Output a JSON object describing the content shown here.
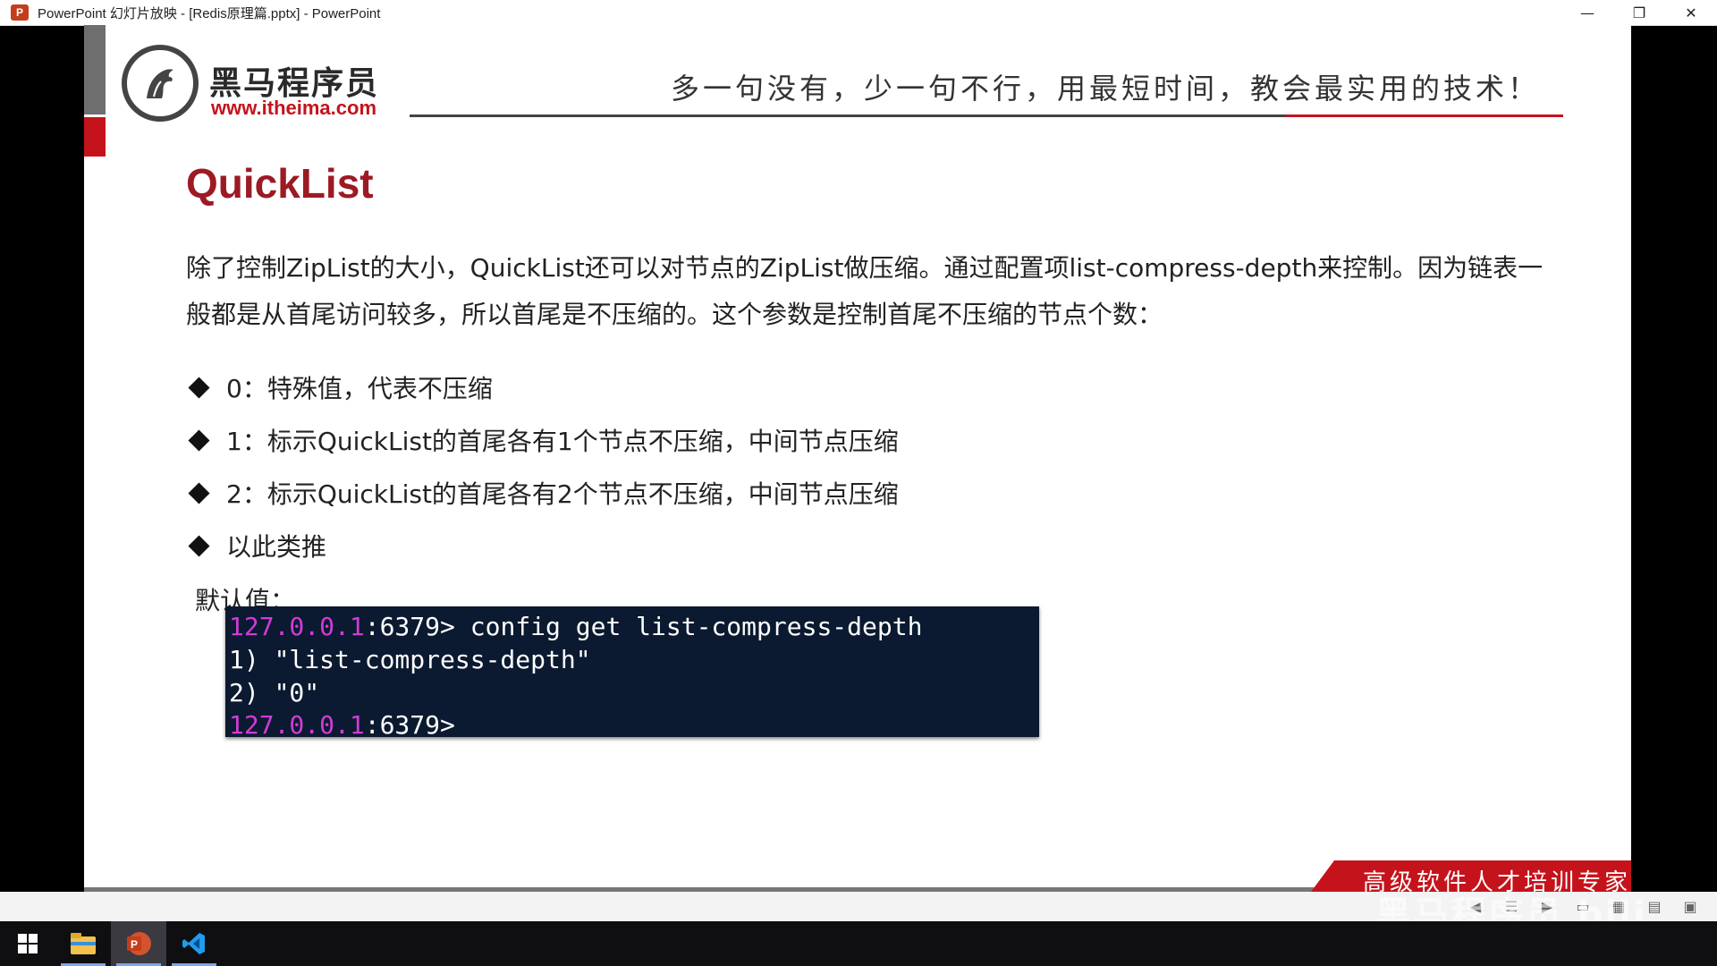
{
  "window": {
    "app_icon": "P",
    "title": "PowerPoint 幻灯片放映 - [Redis原理篇.pptx] - PowerPoint",
    "minimize_glyph": "—",
    "restore_glyph": "❐",
    "close_glyph": "✕"
  },
  "slide": {
    "logo_name": "黑马程序员",
    "logo_url": "www.itheima.com",
    "slogan": "多一句没有，少一句不行，用最短时间，教会最实用的技术！",
    "title": "QuickList",
    "paragraph": "除了控制ZipList的大小，QuickList还可以对节点的ZipList做压缩。通过配置项list-compress-depth来控制。因为链表一般都是从首尾访问较多，所以首尾是不压缩的。这个参数是控制首尾不压缩的节点个数：",
    "bullets": [
      "0：特殊值，代表不压缩",
      "1：标示QuickList的首尾各有1个节点不压缩，中间节点压缩",
      "2：标示QuickList的首尾各有2个节点不压缩，中间节点压缩",
      "以此类推"
    ],
    "default_label": "默认值：",
    "terminal": {
      "ip": "127.0.0.1",
      "port_prompt": ":6379>",
      "command": " config get list-compress-depth",
      "line2": "1) \"list-compress-depth\"",
      "line3": "2) \"0\""
    },
    "footer_slogan": "高级软件人才培训专家"
  },
  "watermark": "黑马程序员 bili",
  "colors": {
    "brand_red": "#c5131c",
    "title_red": "#9c1a24",
    "terminal_bg": "#0b1a30",
    "terminal_ip": "#d23ad9"
  },
  "taskbar": {
    "icons": [
      "windows-start-icon",
      "file-explorer-icon",
      "powerpoint-icon",
      "vscode-icon"
    ]
  }
}
